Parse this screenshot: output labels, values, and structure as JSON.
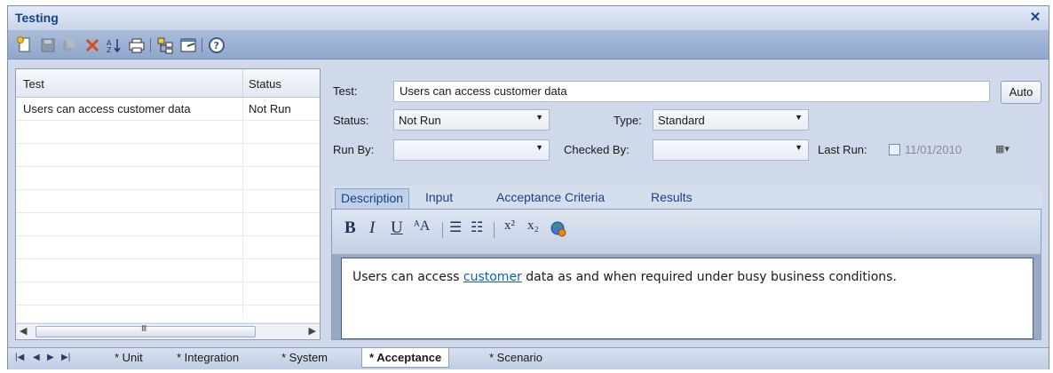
{
  "window": {
    "title": "Testing",
    "close_glyph": "✕"
  },
  "toolbar": {
    "buttons": [
      "new-test-icon",
      "save-icon",
      "copy-icon",
      "delete-icon",
      "sort-icon",
      "print-icon",
      "hierarchy-icon",
      "properties-icon",
      "help-icon"
    ]
  },
  "list": {
    "columns": [
      "Test",
      "Status"
    ],
    "rows": [
      {
        "test": "Users can access customer data",
        "status": "Not Run"
      }
    ],
    "scroll_grip": "III"
  },
  "form": {
    "test_label": "Test:",
    "test_value": "Users can access customer data",
    "auto_label": "Auto",
    "status_label": "Status:",
    "status_value": "Not Run",
    "type_label": "Type:",
    "type_value": "Standard",
    "run_by_label": "Run By:",
    "run_by_value": "",
    "checked_by_label": "Checked By:",
    "checked_by_value": "",
    "last_run_label": "Last Run:",
    "last_run_value": "11/01/2010"
  },
  "tabs": [
    "Description",
    "Input",
    "Acceptance Criteria",
    "Results"
  ],
  "format": {
    "bold": "B",
    "italic": "I",
    "underline": "U",
    "font": "ᴬA",
    "bullets": "☰",
    "numbering": "☷",
    "superscript": "x²",
    "subscript": "x₂"
  },
  "description": {
    "before": "Users can access ",
    "link": "customer",
    "after": " data as and when required under busy business conditions."
  },
  "bottom_tabs": [
    "* Unit",
    "* Integration",
    "* System",
    "* Acceptance",
    "* Scenario"
  ],
  "nav": {
    "first": "|◀",
    "prev": "◀",
    "next": "▶",
    "last": "▶|"
  }
}
